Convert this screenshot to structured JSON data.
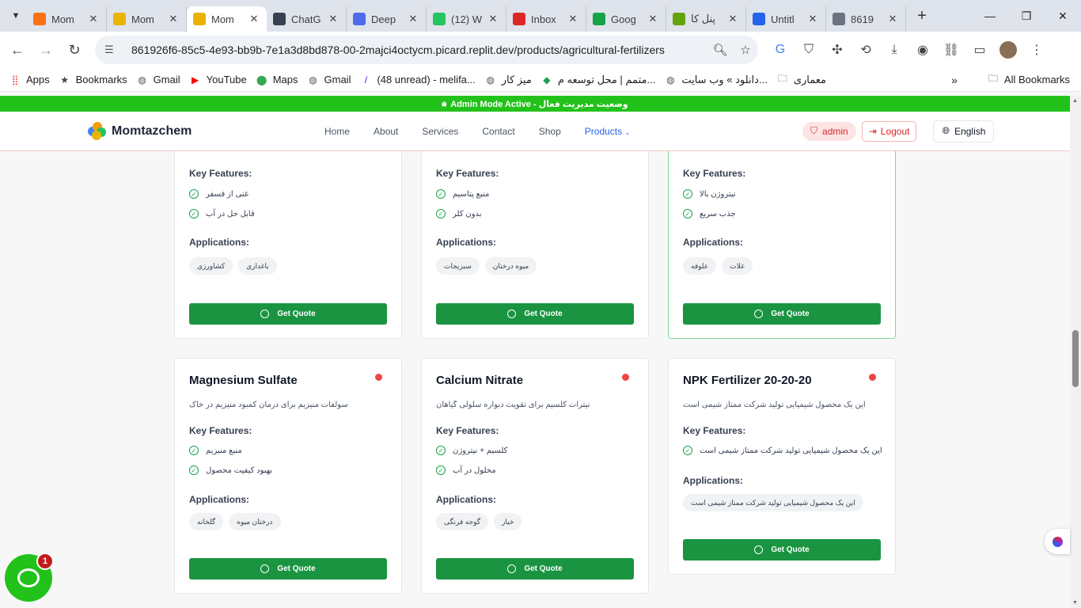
{
  "browser": {
    "tabs": [
      {
        "title": "Mom",
        "favicon_color": "#f97316",
        "active": false
      },
      {
        "title": "Mom",
        "favicon_color": "#eab308",
        "active": false
      },
      {
        "title": "Mom",
        "favicon_color": "#eab308",
        "active": true
      },
      {
        "title": "ChatG",
        "favicon_color": "#374151",
        "active": false
      },
      {
        "title": "Deep",
        "favicon_color": "#4f6bed",
        "active": false
      },
      {
        "title": "(12) W",
        "favicon_color": "#22c55e",
        "active": false
      },
      {
        "title": "Inbox",
        "favicon_color": "#dc2626",
        "active": false
      },
      {
        "title": "Goog",
        "favicon_color": "#16a34a",
        "active": false
      },
      {
        "title": "پنل کا",
        "favicon_color": "#65a30d",
        "active": false
      },
      {
        "title": "Untitl",
        "favicon_color": "#2563eb",
        "active": false
      },
      {
        "title": "8619",
        "favicon_color": "#6b7280",
        "active": false
      }
    ],
    "url": "861926f6-85c5-4e93-bb9b-7e1a3d8bd878-00-2majci4octycm.picard.replit.dev/products/agricultural-fertilizers",
    "bookmarks": [
      {
        "label": "Apps",
        "icon": "apps-grid-icon"
      },
      {
        "label": "Bookmarks",
        "icon": "star-icon"
      },
      {
        "label": "Gmail",
        "icon": "globe-icon"
      },
      {
        "label": "YouTube",
        "icon": "youtube-icon"
      },
      {
        "label": "Maps",
        "icon": "maps-pin-icon"
      },
      {
        "label": "Gmail",
        "icon": "globe-icon"
      },
      {
        "label": "(48 unread) - melifa...",
        "icon": "yahoo-icon"
      },
      {
        "label": "میز کار",
        "icon": "globe-icon"
      },
      {
        "label": "متمم | محل توسعه م...",
        "icon": "motamem-icon"
      },
      {
        "label": "دانلود » وب سایت...",
        "icon": "globe-icon"
      },
      {
        "label": "معماری",
        "icon": "folder-icon"
      }
    ],
    "all_bookmarks": "All Bookmarks"
  },
  "admin_banner": {
    "text": "Admin Mode Active - وضعیت مدیریت فعال"
  },
  "header": {
    "brand": "Momtazchem",
    "nav": [
      "Home",
      "About",
      "Services",
      "Contact",
      "Shop",
      "Products"
    ],
    "admin_label": "admin",
    "logout_label": "Logout",
    "language_label": "English"
  },
  "labels": {
    "key_features": "Key Features:",
    "applications": "Applications:",
    "get_quote": "Get Quote"
  },
  "products_top": [
    {
      "features": [
        "غنی از فسفر",
        "قابل حل در آب"
      ],
      "applications": [
        "کشاورزی",
        "باغداری"
      ]
    },
    {
      "features": [
        "منبع پتاسیم",
        "بدون کلر"
      ],
      "applications": [
        "سبزیجات",
        "میوه درختان"
      ]
    },
    {
      "features": [
        "نیتروژن بالا",
        "جذب سریع"
      ],
      "applications": [
        "علوفه",
        "غلات"
      ]
    }
  ],
  "products_bottom": [
    {
      "name": "Magnesium Sulfate",
      "description": "سولفات منیزیم برای درمان کمبود منیزیم در خاک",
      "features": [
        "منبع منیزیم",
        "بهبود کیفیت محصول"
      ],
      "applications": [
        "گلخانه",
        "درختان میوه"
      ]
    },
    {
      "name": "Calcium Nitrate",
      "description": "نیترات کلسیم برای تقویت دیواره سلولی گیاهان",
      "features": [
        "کلسیم + نیتروژن",
        "محلول در آب"
      ],
      "applications": [
        "گوجه فرنگی",
        "خیار"
      ]
    },
    {
      "name": "NPK Fertilizer 20-20-20",
      "description": "این یک محصول شیمیایی تولید شرکت ممتاز شیمی است",
      "features": [
        "این یک محصول شیمیایی تولید شرکت ممتاز شیمی است"
      ],
      "applications": [
        "این یک محصول شیمیایی تولید شرکت ممتاز شیمی است"
      ]
    }
  ],
  "chat_widget": {
    "badge": "1"
  }
}
